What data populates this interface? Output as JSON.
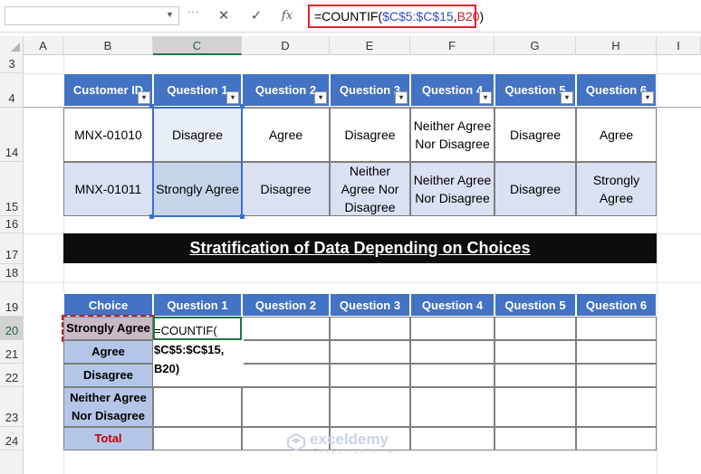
{
  "formula_bar": {
    "namebox_value": "",
    "cancel_icon": "✕",
    "enter_icon": "✓",
    "fx_label": "fx",
    "formula_prefix": "=COUNTIF(",
    "formula_range": "$C$5:$C$15",
    "formula_sep": ",",
    "formula_cell": "B20",
    "formula_suffix": ")"
  },
  "columns": [
    "A",
    "B",
    "C",
    "D",
    "E",
    "F",
    "G",
    "H",
    "I"
  ],
  "rows": [
    "3",
    "4",
    "14",
    "15",
    "16",
    "17",
    "18",
    "19",
    "20",
    "21",
    "22",
    "23",
    "24"
  ],
  "table1": {
    "headers": [
      "Customer ID",
      "Question 1",
      "Question 2",
      "Question 3",
      "Question 4",
      "Question 5",
      "Question 6"
    ],
    "dropdown_icon": "▾",
    "row14": [
      "MNX-01010",
      "Disagree",
      "Agree",
      "Disagree",
      "Neither Agree Nor Disagree",
      "Disagree",
      "Agree"
    ],
    "row15": [
      "MNX-01011",
      "Strongly Agree",
      "Disagree",
      "Neither Agree Nor Disagree",
      "Neither Agree Nor Disagree",
      "Disagree",
      "Strongly Agree"
    ]
  },
  "title": "Stratification of Data Depending on Choices",
  "table2": {
    "headers": [
      "Choice",
      "Question 1",
      "Question 2",
      "Question 3",
      "Question 4",
      "Question 5",
      "Question 6"
    ],
    "choices": [
      "Strongly Agree",
      "Agree",
      "Disagree",
      "Neither Agree Nor Disagree"
    ],
    "total_label": "Total",
    "editing_line1": "=COUNTIF(",
    "editing_line2": "$C$5:$C$15,",
    "editing_line3": "B20)"
  },
  "watermark": {
    "name": "exceldemy",
    "tagline": "EXCEL · DATA · BI"
  },
  "colors": {
    "header_blue": "#4472c4",
    "label_blue": "#b4c6e7",
    "band_blue": "#d9e1f2",
    "accent_red": "#e8202a",
    "excel_green": "#217346"
  }
}
